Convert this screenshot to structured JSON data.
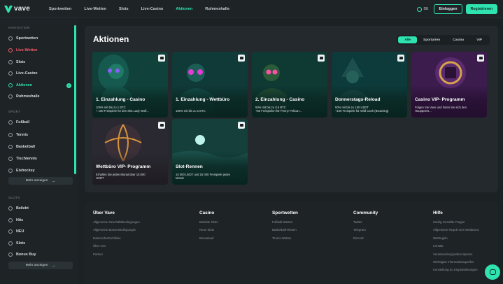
{
  "brand": {
    "name": "vave",
    "accent": "#2fe3b0"
  },
  "topnav": {
    "items": [
      "Sportwetten",
      "Live-Wetten",
      "Slots",
      "Live-Casino",
      "Aktionen",
      "Ruhmeshalle"
    ],
    "active": "Aktionen",
    "lang": "DE",
    "login_label": "Einloggen",
    "register_label": "Registrieren"
  },
  "sidebar": {
    "nav_section": "NAVIGATION",
    "nav": [
      {
        "label": "Sportwetten",
        "icon": "soccer-ball-icon"
      },
      {
        "label": "Live-Wetten",
        "icon": "live-icon",
        "live": true
      },
      {
        "label": "Slots",
        "icon": "slot-icon"
      },
      {
        "label": "Live-Casino",
        "icon": "cards-icon"
      },
      {
        "label": "Aktionen",
        "icon": "promo-icon",
        "active": true,
        "badge": "7"
      },
      {
        "label": "Ruhmeshalle",
        "icon": "trophy-icon"
      }
    ],
    "sport_section": "SPORT",
    "sport": [
      "Fußball",
      "Tennis",
      "Basketball",
      "Tischtennis",
      "Eishockey"
    ],
    "more_label_1": "Mehr anzeigen",
    "slots_section": "SLOTS",
    "slots": [
      "Beliebt",
      "Hits",
      "NEU",
      "Slots",
      "Bonus Buy"
    ],
    "more_label_2": "Mehr anzeigen"
  },
  "main": {
    "title": "Aktionen",
    "filters": [
      "Alle",
      "Sportarten",
      "Casino",
      "VIP"
    ],
    "active_filter": "Alle",
    "cards": [
      {
        "title": "1. Einzahlung - Casino",
        "desc1": "100% mit bis zu 1 BTC",
        "desc2": "+ 100 Freispiele für den Slot Lady Wolf...",
        "theme": "cyan"
      },
      {
        "title": "1. Einzahlung - Wettbüro",
        "desc1": "100% mit bis zu 1 BTC",
        "desc2": "",
        "theme": "magenta"
      },
      {
        "title": "2. Einzahlung - Casino",
        "desc1": "50% mit bis zu 0.5 BTC",
        "desc2": "+50 Freispielen für Penny Pelican...",
        "theme": "green"
      },
      {
        "title": "Donnerstags-Reload",
        "desc1": "50% mit bis zu 150 USDT",
        "desc2": "+100 Freispiele für Wild Cash (BGaming)",
        "theme": "teal"
      },
      {
        "title": "Casino VIP- Programm",
        "desc1": "Folgen Sie Vave und holen Sie sich den",
        "desc2": "Hauptpreis...",
        "theme": "purple"
      },
      {
        "title": "Wettbüro VIP- Programm",
        "desc1": "Erhalten Sie jeden Monat über 10.000",
        "desc2": "USDT",
        "theme": "ball"
      },
      {
        "title": "Slot-Rennen",
        "desc1": "15 000 USDT und 15 000 Freispiele jeden",
        "desc2": "Monat",
        "theme": "moon"
      }
    ]
  },
  "footer": {
    "columns": [
      {
        "head": "Über Vave",
        "links": [
          "Allgemeine Geschäftsbedingungen",
          "Allgemeine Bonus-Bedingungen",
          "Datenschutzrichtlinie",
          "Über Uns",
          "Partner"
        ]
      },
      {
        "head": "Casino",
        "links": [
          "Beliebte Slots",
          "Neue Slots",
          "Bonuskauf"
        ]
      },
      {
        "head": "Sportwetten",
        "links": [
          "Fußball-Wetten",
          "Basketball-Wetten",
          "Tennis-Wetten"
        ]
      },
      {
        "head": "Community",
        "links": [
          "Twitter",
          "Telegram",
          "Discord"
        ]
      },
      {
        "head": "Hilfe",
        "links": [
          "Häufig Gestellte Fragen",
          "Allgemeine Regeln Des Wettbüros",
          "Wettregeln",
          "Kontakt",
          "Verantwortungsvolles Spielen",
          "Wichtigste Informationsquellen",
          "Konstellung Zu Kryptowährungen"
        ]
      }
    ]
  }
}
